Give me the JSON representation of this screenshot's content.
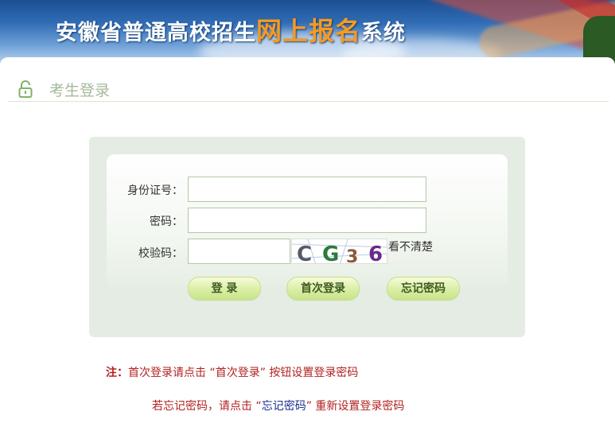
{
  "header": {
    "title_part1": "安徽省普通高校招生",
    "title_highlight": "网上报名",
    "title_part2": "系统"
  },
  "section": {
    "title": "考生登录",
    "icon": "lock-icon"
  },
  "form": {
    "id_label": "身份证号：",
    "id_value": "",
    "password_label": "密码：",
    "password_value": "",
    "code_label": "校验码：",
    "code_value": "",
    "captcha_text": "CG36",
    "refresh_label": "看不清楚"
  },
  "buttons": {
    "login": "登 录",
    "first_login": "首次登录",
    "forgot_password": "忘记密码"
  },
  "notes": {
    "note1_prefix": "注：",
    "note1_text": "首次登录请点击 “首次登录” 按钮设置登录密码",
    "note2_before": "若忘记密码，请点击 “",
    "note2_link": "忘记密码",
    "note2_after": "” 重新设置登录密码"
  },
  "colors": {
    "accent_green": "#c8e38a",
    "note_red": "#b22222",
    "note_blue": "#1c2f8f",
    "highlight_orange": "#f59a23"
  }
}
